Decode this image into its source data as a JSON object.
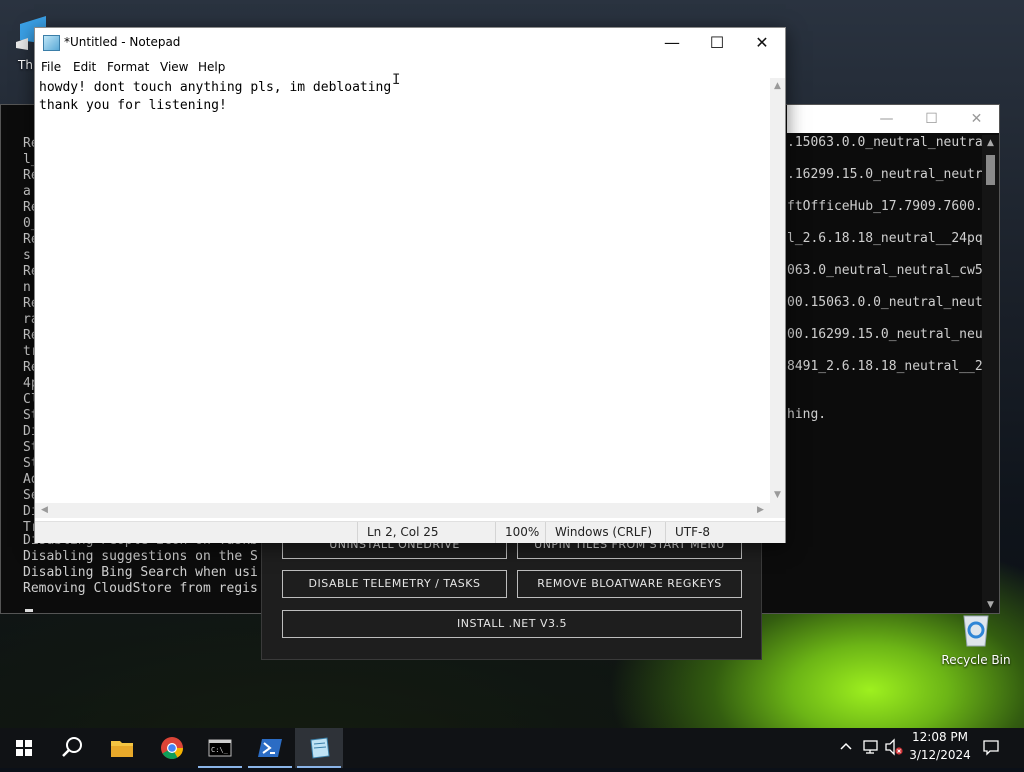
{
  "desktop": {
    "top_icon_label": "Th",
    "recycle_bin_label": "Recycle Bin"
  },
  "console": {
    "left_fragments": [
      "Re",
      "l_",
      "Re",
      "a",
      "Re",
      "0_",
      "Re",
      "s",
      "Re",
      "n",
      "Re",
      "ra",
      "Re",
      "tr",
      "Re",
      "4p",
      "Cl",
      "St",
      "Di",
      "St",
      "St",
      "Ad",
      "Se",
      "Di",
      "Tr"
    ],
    "right_lines": [
      ".15063.0.0_neutral_neutra",
      ".16299.15.0_neutral_neutr",
      "ftOfficeHub_17.7909.7600.",
      "l_2.6.18.18_neutral__24pq",
      "063.0_neutral_neutral_cw5",
      "00.15063.0.0_neutral_neut",
      "00.16299.15.0_neutral_neu",
      "8491_2.6.18.18_neutral__2"
    ],
    "right_line_extra": "hing.",
    "bottom_lines": [
      "Disabling People icon on Taskb",
      "Disabling suggestions on the S",
      "Disabling Bing Search when usi",
      "Removing CloudStore from regis"
    ]
  },
  "panel": {
    "btn_uninstall_onedrive": "UNINSTALL ONEDRIVE",
    "btn_unpin_tiles": "UNPIN TILES FROM START MENU",
    "btn_disable_telemetry": "DISABLE TELEMETRY / TASKS",
    "btn_remove_bloatware": "REMOVE BLOATWARE REGKEYS",
    "btn_install_net": "INSTALL .NET V3.5"
  },
  "notepad": {
    "title": "*Untitled - Notepad",
    "menu": [
      "File",
      "Edit",
      "Format",
      "View",
      "Help"
    ],
    "text": "howdy! dont touch anything pls, im debloating\nthank you for listening!",
    "status": {
      "position": "Ln 2, Col 25",
      "zoom": "100%",
      "line_ending": "Windows (CRLF)",
      "encoding": "UTF-8"
    }
  },
  "taskbar": {
    "clock_time": "12:08 PM",
    "clock_date": "3/12/2024",
    "items": [
      "start-icon",
      "search-icon",
      "file-explorer-icon",
      "chrome-icon",
      "command-prompt-icon",
      "powershell-icon",
      "notepad-icon"
    ]
  }
}
